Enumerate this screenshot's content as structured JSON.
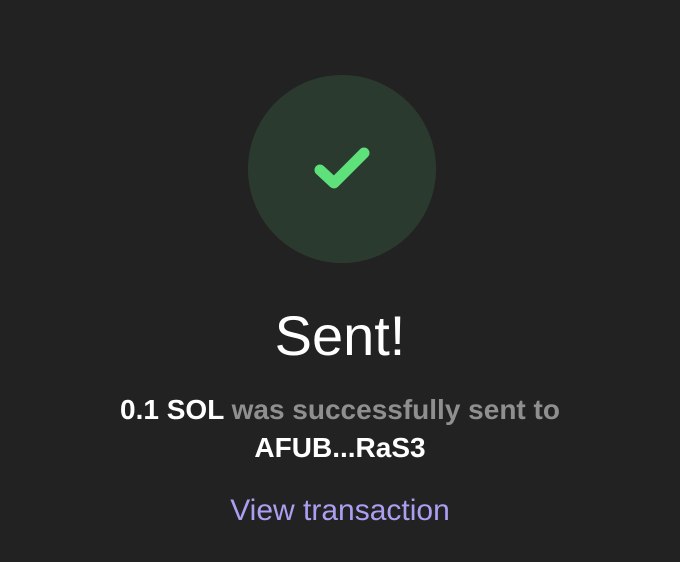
{
  "status": {
    "icon": "checkmark-icon",
    "circle_color": "#2b3a2f",
    "check_color": "#5ee07a",
    "title": "Sent!"
  },
  "message": {
    "amount": "0.1 SOL",
    "text": " was successfully sent to",
    "recipient": "AFUB...RaS3"
  },
  "link": {
    "label": "View transaction",
    "color": "#ab9ff2"
  }
}
